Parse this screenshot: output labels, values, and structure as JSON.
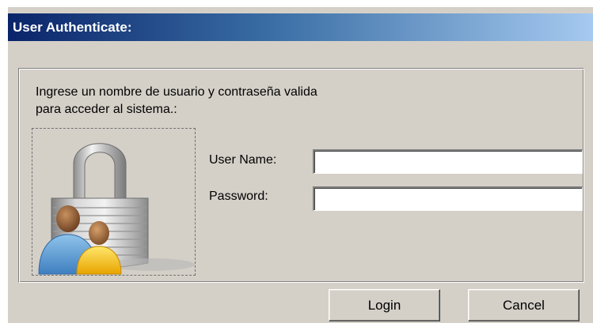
{
  "window": {
    "title": "User Authenticate:",
    "titlebar_gradient": [
      "#0a246a",
      "#3a6ea5",
      "#a6caf0"
    ],
    "background": "#d4d0c8"
  },
  "panel": {
    "instructions_line1": "Ingrese un nombre de usuario y contraseña valida",
    "instructions_line2": "para acceder al sistema.:",
    "image_icon": "padlock-users-icon"
  },
  "form": {
    "username_label": "User Name:",
    "username_value": "",
    "password_label": "Password:",
    "password_value": ""
  },
  "buttons": {
    "login_label": "Login",
    "cancel_label": "Cancel"
  }
}
